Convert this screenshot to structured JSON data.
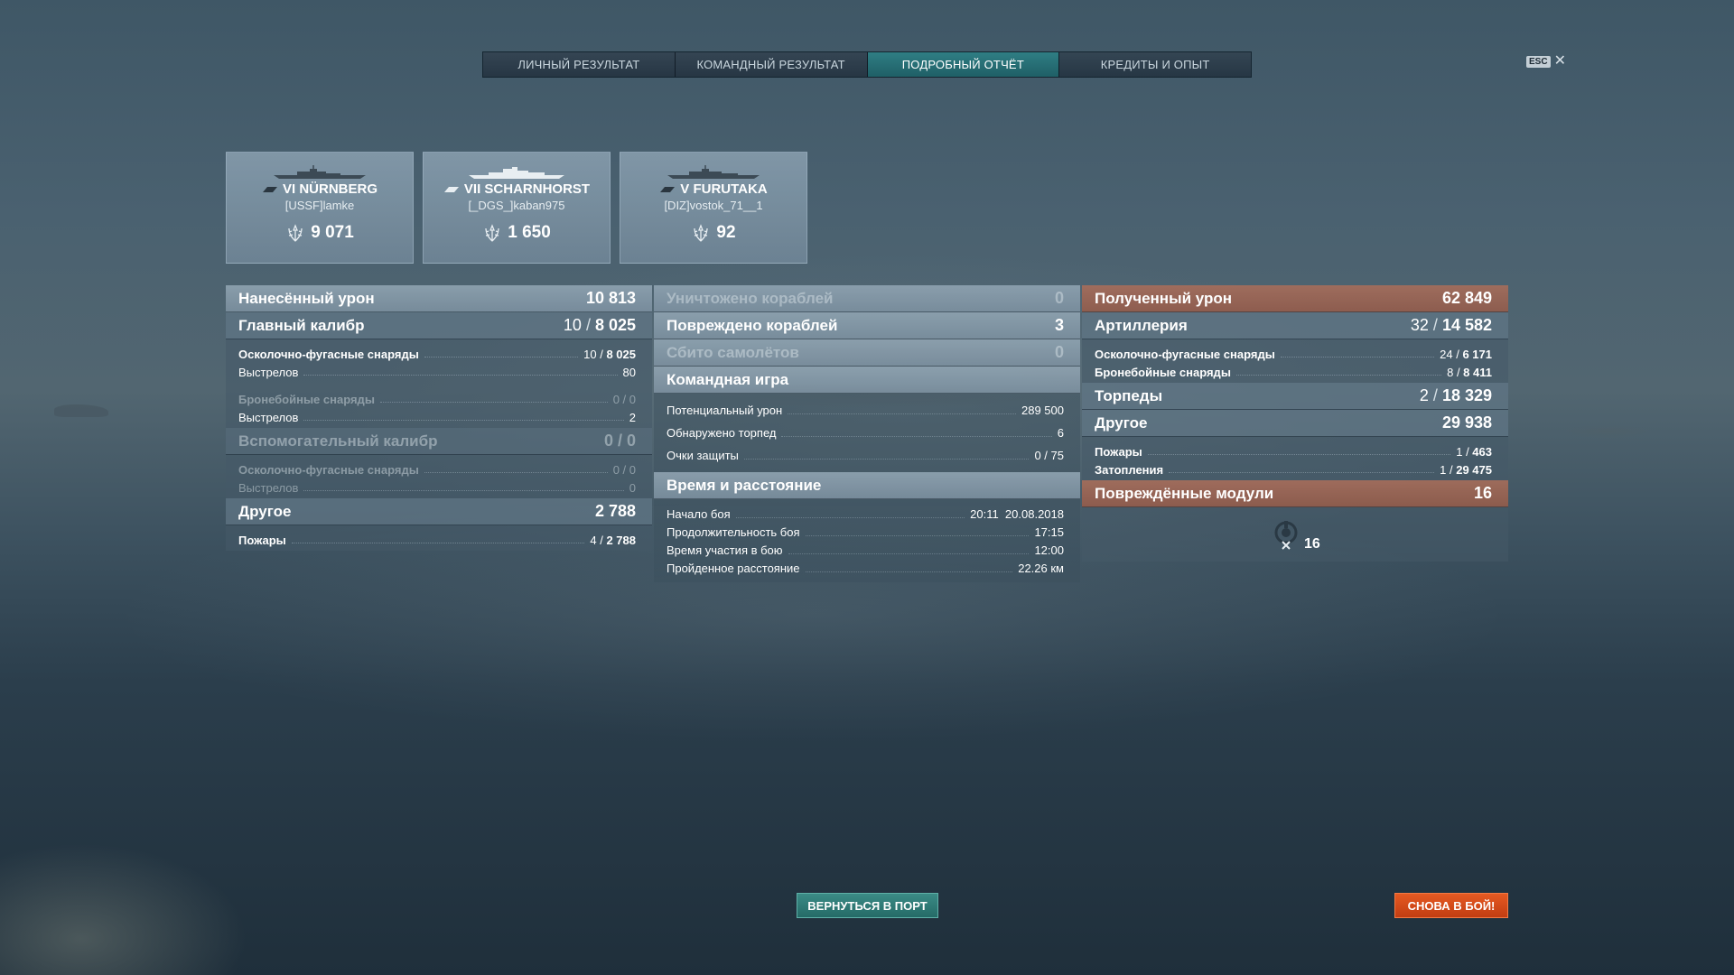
{
  "tabs": [
    {
      "label": "ЛИЧНЫЙ РЕЗУЛЬТАТ",
      "active": false
    },
    {
      "label": "КОМАНДНЫЙ РЕЗУЛЬТАТ",
      "active": false
    },
    {
      "label": "ПОДРОБНЫЙ ОТЧЁТ",
      "active": true
    },
    {
      "label": "КРЕДИТЫ И ОПЫТ",
      "active": false
    }
  ],
  "close": {
    "key": "ESC",
    "icon": "close-icon"
  },
  "ships": [
    {
      "name": "VI NÜRNBERG",
      "player": "[USSF]lamke",
      "score": "9 071"
    },
    {
      "name": "VII SCHARNHORST",
      "player": "[_DGS_]kaban975",
      "score": "1 650"
    },
    {
      "name": "V FURUTAKA",
      "player": "[DIZ]vostok_71__1",
      "score": "92"
    }
  ],
  "damage": {
    "header": {
      "label": "Нанесённый урон",
      "value": "10 813"
    },
    "main": {
      "label": "Главный калибр",
      "hits": "10",
      "value": "8 025"
    },
    "he_label": "Осколочно-фугасные снаряды",
    "he_hits": "10",
    "he_value": "8 025",
    "shots_label": "Выстрелов",
    "he_shots": "80",
    "ap_label": "Бронебойные снаряды",
    "ap_value": "0 / 0",
    "ap_shots": "2",
    "secondary": {
      "label": "Вспомогательный калибр",
      "value": "0 / 0"
    },
    "sec_he_label": "Осколочно-фугасные снаряды",
    "sec_he_value": "0 / 0",
    "sec_shots": "0",
    "other": {
      "label": "Другое",
      "value": "2 788"
    },
    "fires_label": "Пожары",
    "fires_hits": "4",
    "fires_value": "2 788"
  },
  "middle": {
    "destroyed": {
      "label": "Уничтожено кораблей",
      "value": "0"
    },
    "damaged": {
      "label": "Повреждено кораблей",
      "value": "3"
    },
    "planes": {
      "label": "Сбито самолётов",
      "value": "0"
    },
    "team": {
      "label": "Командная игра"
    },
    "potential_label": "Потенциальный урон",
    "potential_value": "289 500",
    "torpedo_label": "Обнаружено торпед",
    "torpedo_value": "6",
    "defense_label": "Очки защиты",
    "defense_value": "0 / 75",
    "time": {
      "label": "Время и расстояние"
    },
    "start_label": "Начало боя",
    "start_value": "20:11  20.08.2018",
    "duration_label": "Продолжительность боя",
    "duration_value": "17:15",
    "participation_label": "Время участия в бою",
    "participation_value": "12:00",
    "distance_label": "Пройденное расстояние",
    "distance_value": "22.26 км"
  },
  "received": {
    "header": {
      "label": "Полученный урон",
      "value": "62 849"
    },
    "artillery": {
      "label": "Артиллерия",
      "hits": "32",
      "value": "14 582"
    },
    "he_label": "Осколочно-фугасные снаряды",
    "he_hits": "24",
    "he_value": "6 171",
    "ap_label": "Бронебойные снаряды",
    "ap_hits": "8",
    "ap_value": "8 411",
    "torpedoes": {
      "label": "Торпеды",
      "hits": "2",
      "value": "18 329"
    },
    "other": {
      "label": "Другое",
      "value": "29 938"
    },
    "fires_label": "Пожары",
    "fires_hits": "1",
    "fires_value": "463",
    "flooding_label": "Затопления",
    "flooding_hits": "1",
    "flooding_value": "29 475",
    "modules": {
      "label": "Повреждённые модули",
      "value": "16",
      "count": "16"
    }
  },
  "buttons": {
    "port": "ВЕРНУТЬСЯ В ПОРТ",
    "battle": "СНОВА В БОЙ!"
  },
  "colors": {
    "accent_teal": "#2f7e84",
    "battle_orange": "#e65a22",
    "received_header": "#aa6e5a"
  }
}
